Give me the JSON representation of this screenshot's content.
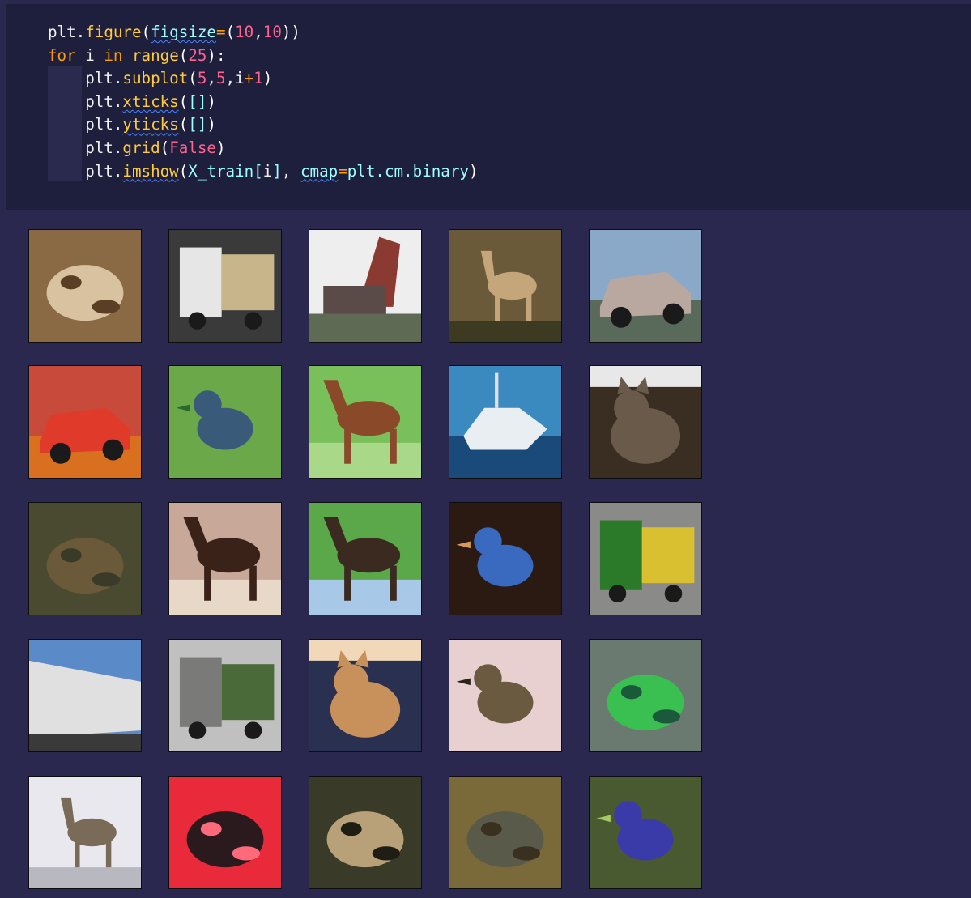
{
  "code": {
    "lines": [
      [
        {
          "t": "plt.",
          "c": "plain"
        },
        {
          "t": "figure",
          "c": "func"
        },
        {
          "t": "(",
          "c": "bracket"
        },
        {
          "t": "figsize",
          "c": "param",
          "sq": true
        },
        {
          "t": "=",
          "c": "op"
        },
        {
          "t": "(",
          "c": "bracket"
        },
        {
          "t": "10",
          "c": "num"
        },
        {
          "t": ",",
          "c": "plain"
        },
        {
          "t": "10",
          "c": "num"
        },
        {
          "t": "))",
          "c": "bracket"
        }
      ],
      [
        {
          "t": "for",
          "c": "kw"
        },
        {
          "t": " i ",
          "c": "plain"
        },
        {
          "t": "in",
          "c": "kw"
        },
        {
          "t": " ",
          "c": "plain"
        },
        {
          "t": "range",
          "c": "func"
        },
        {
          "t": "(",
          "c": "bracket"
        },
        {
          "t": "25",
          "c": "num"
        },
        {
          "t": "):",
          "c": "bracket"
        }
      ],
      [
        {
          "t": "    plt.",
          "c": "plain"
        },
        {
          "t": "subplot",
          "c": "func"
        },
        {
          "t": "(",
          "c": "bracket"
        },
        {
          "t": "5",
          "c": "num"
        },
        {
          "t": ",",
          "c": "plain"
        },
        {
          "t": "5",
          "c": "num"
        },
        {
          "t": ",i",
          "c": "plain"
        },
        {
          "t": "+",
          "c": "op"
        },
        {
          "t": "1",
          "c": "num"
        },
        {
          "t": ")",
          "c": "bracket"
        }
      ],
      [
        {
          "t": "    plt.",
          "c": "plain"
        },
        {
          "t": "xticks",
          "c": "func",
          "sq": true
        },
        {
          "t": "(",
          "c": "bracket"
        },
        {
          "t": "[]",
          "c": "param"
        },
        {
          "t": ")",
          "c": "bracket"
        }
      ],
      [
        {
          "t": "    plt.",
          "c": "plain"
        },
        {
          "t": "yticks",
          "c": "func",
          "sq": true
        },
        {
          "t": "(",
          "c": "bracket"
        },
        {
          "t": "[]",
          "c": "param"
        },
        {
          "t": ")",
          "c": "bracket"
        }
      ],
      [
        {
          "t": "    plt.",
          "c": "plain"
        },
        {
          "t": "grid",
          "c": "func"
        },
        {
          "t": "(",
          "c": "bracket"
        },
        {
          "t": "False",
          "c": "num"
        },
        {
          "t": ")",
          "c": "bracket"
        }
      ],
      [
        {
          "t": "    plt.",
          "c": "plain"
        },
        {
          "t": "imshow",
          "c": "func",
          "sq": true
        },
        {
          "t": "(",
          "c": "bracket"
        },
        {
          "t": "X_train",
          "c": "var"
        },
        {
          "t": "[",
          "c": "param"
        },
        {
          "t": "i",
          "c": "plain"
        },
        {
          "t": "]",
          "c": "param"
        },
        {
          "t": ", ",
          "c": "plain"
        },
        {
          "t": "cmap",
          "c": "param",
          "sq": true
        },
        {
          "t": "=",
          "c": "op"
        },
        {
          "t": "plt.cm.binary",
          "c": "var"
        },
        {
          "t": ")",
          "c": "bracket"
        }
      ]
    ]
  },
  "output": {
    "images": [
      {
        "name": "frog-image",
        "bg": "#8a6a45",
        "fg": "#d8c2a0",
        "accent": "#5a3f25",
        "shape": "blob"
      },
      {
        "name": "truck-image",
        "bg": "#3a3a3a",
        "fg": "#e6e6e6",
        "accent": "#c8b58a",
        "shape": "truck"
      },
      {
        "name": "dump-truck-image",
        "bg": "#eeeeee",
        "fg": "#8a3a30",
        "accent": "#5f6a55",
        "shape": "ramp"
      },
      {
        "name": "deer-image",
        "bg": "#6a5a3a",
        "fg": "#c4a67a",
        "accent": "#3d3a22",
        "shape": "deer"
      },
      {
        "name": "car-image",
        "bg": "#8aa8c8",
        "fg": "#b8a8a0",
        "accent": "#5a6a5a",
        "shape": "car"
      },
      {
        "name": "red-car-image",
        "bg": "#c84a3a",
        "fg": "#e03a2a",
        "accent": "#d97020",
        "shape": "car"
      },
      {
        "name": "bird-image",
        "bg": "#6aa84a",
        "fg": "#3a5a7a",
        "accent": "#2a6a2a",
        "shape": "bird"
      },
      {
        "name": "horse-image",
        "bg": "#7ac05a",
        "fg": "#8a4a2a",
        "accent": "#a8d888",
        "shape": "horse"
      },
      {
        "name": "ship-image",
        "bg": "#3a8ac0",
        "fg": "#e8eef2",
        "accent": "#1a4a7a",
        "shape": "ship"
      },
      {
        "name": "cat-image",
        "bg": "#3a2e22",
        "fg": "#6a5a4a",
        "accent": "#e8e8e8",
        "shape": "cat"
      },
      {
        "name": "deer-forest-image",
        "bg": "#4a4a30",
        "fg": "#6a5a3a",
        "accent": "#3a3a28",
        "shape": "blob"
      },
      {
        "name": "horse-rider-image",
        "bg": "#c8a898",
        "fg": "#3a2218",
        "accent": "#e8d8c8",
        "shape": "horse"
      },
      {
        "name": "horse-field-image",
        "bg": "#5aa84a",
        "fg": "#3a2a20",
        "accent": "#a8c8e8",
        "shape": "horse"
      },
      {
        "name": "bluebird-image",
        "bg": "#2a1a12",
        "fg": "#3a6ac0",
        "accent": "#d89a5a",
        "shape": "bird"
      },
      {
        "name": "green-truck-image",
        "bg": "#8a8a88",
        "fg": "#2a7a2a",
        "accent": "#d8c030",
        "shape": "truck"
      },
      {
        "name": "trailer-image",
        "bg": "#5a8ac8",
        "fg": "#e0e0e0",
        "accent": "#3a3a3a",
        "shape": "trailer"
      },
      {
        "name": "truck-people-image",
        "bg": "#c0c0c0",
        "fg": "#7a7a78",
        "accent": "#4a6a3a",
        "shape": "truck"
      },
      {
        "name": "cat-sitting-image",
        "bg": "#2a3050",
        "fg": "#c8905a",
        "accent": "#f0d8b8",
        "shape": "cat"
      },
      {
        "name": "sparrow-image",
        "bg": "#e8d0d0",
        "fg": "#6a5a40",
        "accent": "#2a2418",
        "shape": "bird"
      },
      {
        "name": "frog-statue-image",
        "bg": "#6a7a70",
        "fg": "#3ac050",
        "accent": "#1a5a3a",
        "shape": "blob"
      },
      {
        "name": "deer-snow-image",
        "bg": "#e8e8ee",
        "fg": "#7a6a58",
        "accent": "#b8b8c0",
        "shape": "deer"
      },
      {
        "name": "black-frog-image",
        "bg": "#e82a3a",
        "fg": "#2a1a1e",
        "accent": "#ff6a7a",
        "shape": "blob"
      },
      {
        "name": "toad-image",
        "bg": "#3a3a28",
        "fg": "#b8a078",
        "accent": "#1e1e14",
        "shape": "blob"
      },
      {
        "name": "toad-ground-image",
        "bg": "#7a6a3a",
        "fg": "#5a5a4a",
        "accent": "#3a3020",
        "shape": "blob"
      },
      {
        "name": "cassowary-image",
        "bg": "#4a5a30",
        "fg": "#3a3aa8",
        "accent": "#a8c868",
        "shape": "bird"
      }
    ]
  }
}
